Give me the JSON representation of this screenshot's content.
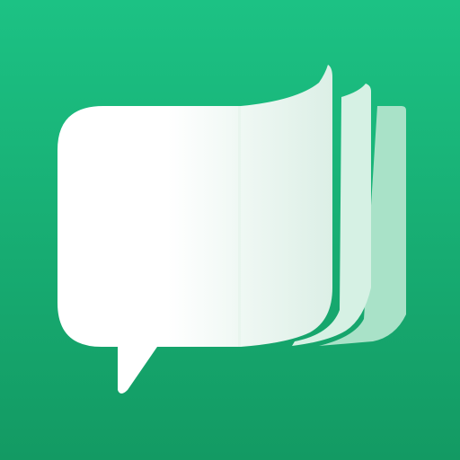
{
  "icon": {
    "name": "chat-book-app-icon",
    "colors": {
      "background_top": "#1CC284",
      "background_bottom": "#139A63",
      "page_white": "#FFFFFF",
      "page_shade": "#DCEFE6",
      "page_back_1": "#D6F1E4",
      "page_back_2": "#A9E2C8"
    }
  }
}
